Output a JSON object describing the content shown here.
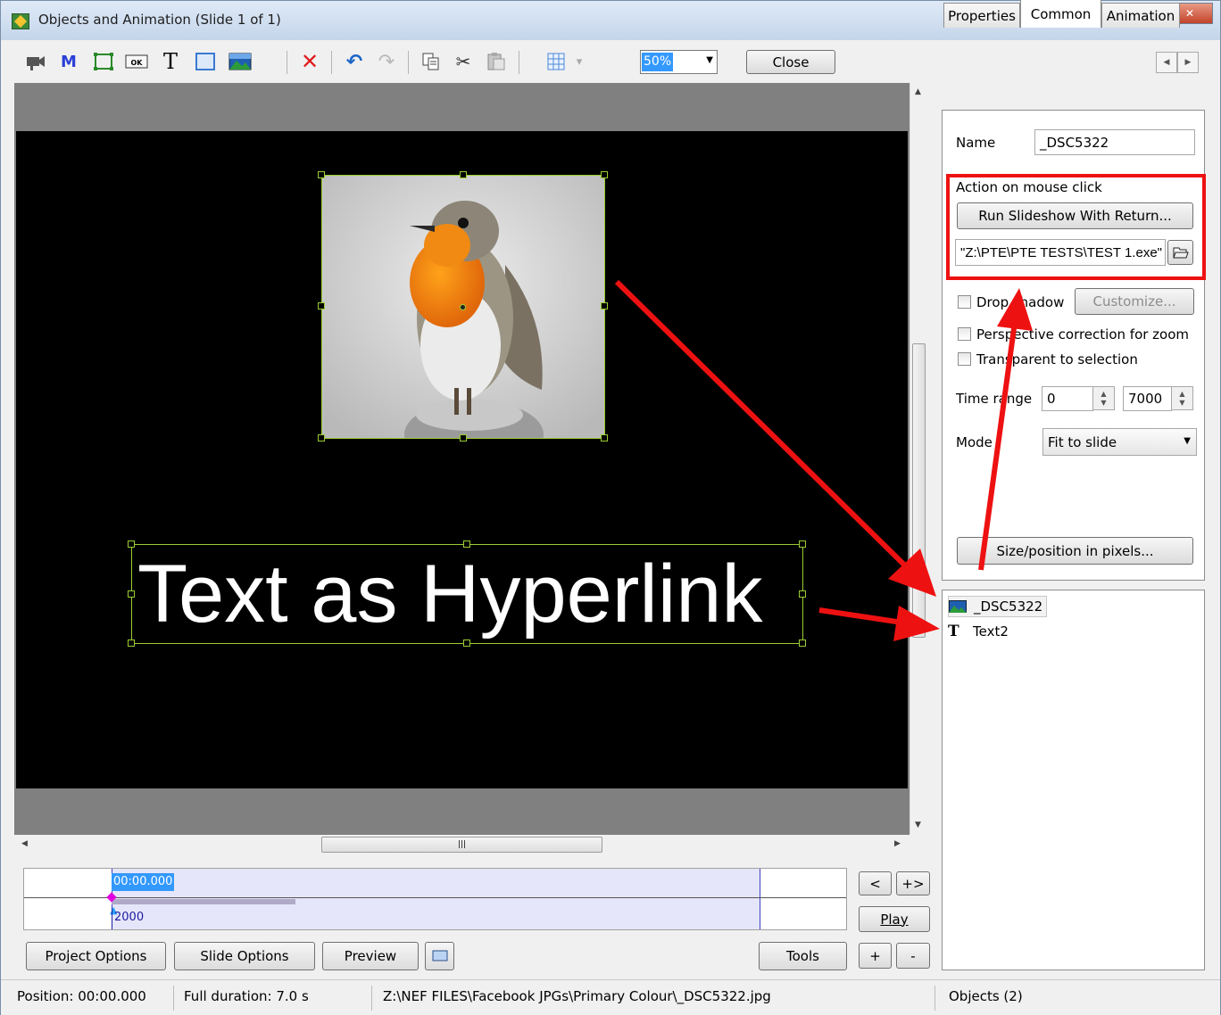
{
  "window": {
    "title": "Objects and Animation  (Slide 1 of 1)",
    "minimize": "▁",
    "maximize": "▭",
    "close": "✕"
  },
  "toolbar": {
    "zoom_value": "50%",
    "close_label": "Close",
    "grid_dropdown": "▾"
  },
  "slide": {
    "text_object": "Text as Hyperlink"
  },
  "tabs": [
    {
      "label": "Properties"
    },
    {
      "label": "Common"
    },
    {
      "label": "Animation"
    }
  ],
  "properties": {
    "name_label": "Name",
    "name_value": "_DSC5322",
    "action_label": "Action on mouse click",
    "action_button": "Run Slideshow With Return...",
    "action_path": "\"Z:\\PTE\\PTE TESTS\\TEST 1.exe\"",
    "drop_shadow_label": "Drop shadow",
    "customize_label": "Customize...",
    "perspective_label": "Perspective correction for zoom",
    "transparent_label": "Transparent to selection",
    "time_range_label": "Time range",
    "time_start": "0",
    "time_end": "7000",
    "mode_label": "Mode",
    "mode_value": "Fit to slide",
    "size_button": "Size/position in pixels..."
  },
  "objects": [
    {
      "label": "_DSC5322",
      "icon": "image-icon"
    },
    {
      "label": "Text2",
      "icon": "text-icon"
    }
  ],
  "timeline": {
    "current_time": "00:00.000",
    "marker_value": "2000"
  },
  "nav": {
    "prev": "<",
    "next_add": "+>",
    "play": "Play",
    "plus": "+",
    "minus": "-"
  },
  "bottom_buttons": {
    "project_options": "Project Options",
    "slide_options": "Slide Options",
    "preview": "Preview",
    "tools": "Tools"
  },
  "status": {
    "position": "Position:  00:00.000",
    "duration": "Full duration:  7.0 s",
    "path": "Z:\\NEF FILES\\Facebook JPGs\\Primary Colour\\_DSC5322.jpg",
    "objects": "Objects (2)"
  },
  "colors": {
    "highlight": "#ee1111",
    "selection_handle": "#9acd32",
    "accent": "#3399ff"
  }
}
